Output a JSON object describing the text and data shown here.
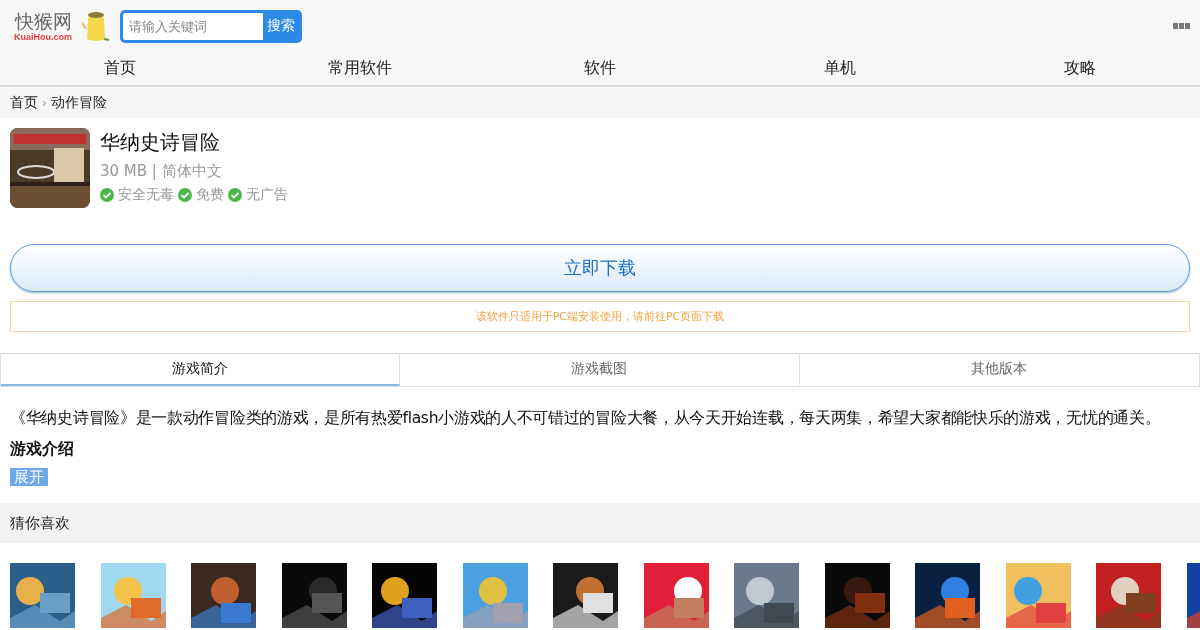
{
  "logo": {
    "name": "快猴网",
    "domain": "KuaiHou.com"
  },
  "search": {
    "placeholder": "请输入关键词",
    "button": "搜索"
  },
  "nav": [
    {
      "label": "首页"
    },
    {
      "label": "常用软件"
    },
    {
      "label": "软件"
    },
    {
      "label": "单机"
    },
    {
      "label": "攻略"
    }
  ],
  "breadcrumb": {
    "items": [
      "首页",
      "动作冒险"
    ],
    "separator": "›"
  },
  "app": {
    "title": "华纳史诗冒险",
    "meta": "30 MB | 简体中文",
    "badges": [
      "安全无毒",
      "免费",
      "无广告"
    ]
  },
  "download": {
    "label": "立即下载",
    "note": "该软件只适用于PC端安装使用，请前往PC页面下载"
  },
  "tabs": [
    {
      "label": "游戏简介",
      "selected": true
    },
    {
      "label": "游戏截图",
      "selected": false
    },
    {
      "label": "其他版本",
      "selected": false
    }
  ],
  "description": "《华纳史诗冒险》是一款动作冒险类的游戏，是所有热爱flash小游戏的人不可错过的冒险大餐，从今天开始连载，每天两集，希望大家都能快乐的游戏，无忧的通关。",
  "intro_heading": "游戏介绍",
  "expand": "展开",
  "recommend": {
    "title": "猜你喜欢"
  }
}
